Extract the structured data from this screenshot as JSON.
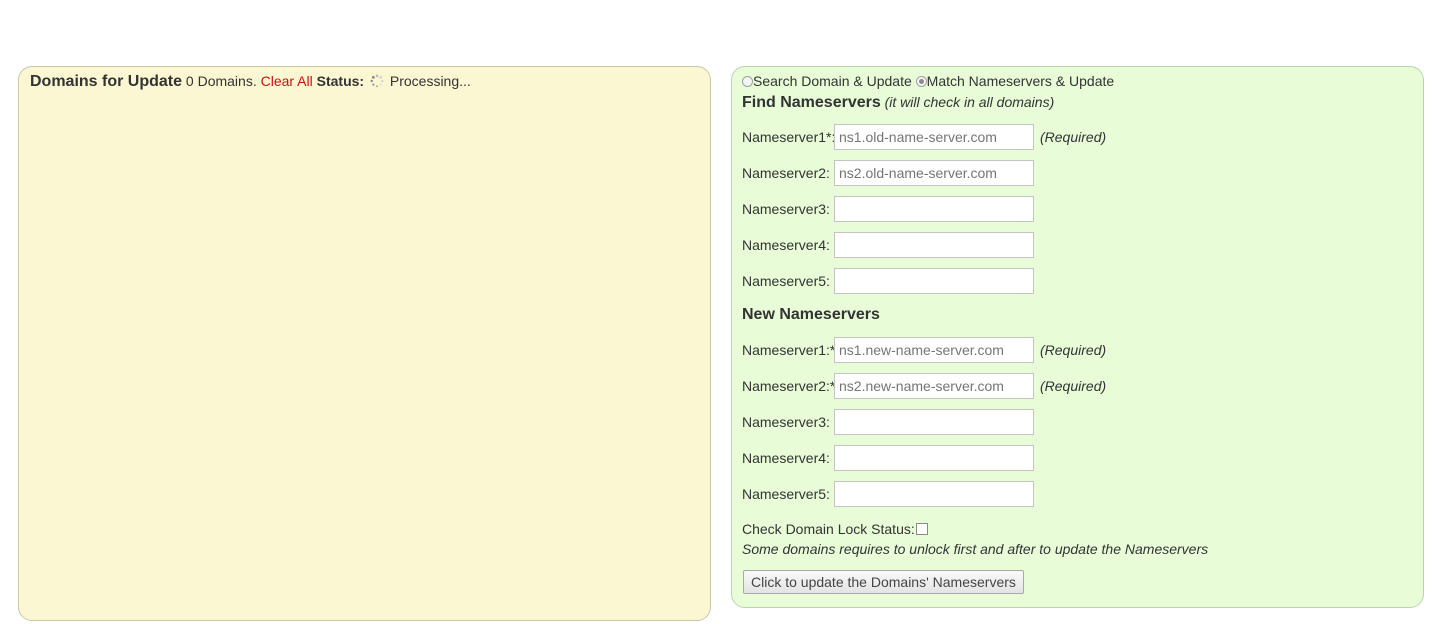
{
  "domains_panel": {
    "title": "Domains for Update",
    "count_text": "0 Domains.",
    "clear_all": "Clear All",
    "status_label": "Status:",
    "status_value": "Processing..."
  },
  "mode": {
    "options": [
      {
        "label": "Search Domain & Update",
        "checked": false
      },
      {
        "label": "Match Nameservers & Update",
        "checked": true
      }
    ]
  },
  "find_section": {
    "title": "Find Nameservers",
    "note": "(it will check in all domains)",
    "fields": [
      {
        "label": "Nameserver1*:",
        "placeholder": "ns1.old-name-server.com",
        "value": "",
        "required_note": "(Required)"
      },
      {
        "label": "Nameserver2:",
        "placeholder": "ns2.old-name-server.com",
        "value": "",
        "required_note": ""
      },
      {
        "label": "Nameserver3:",
        "placeholder": "",
        "value": "",
        "required_note": ""
      },
      {
        "label": "Nameserver4:",
        "placeholder": "",
        "value": "",
        "required_note": ""
      },
      {
        "label": "Nameserver5:",
        "placeholder": "",
        "value": "",
        "required_note": ""
      }
    ]
  },
  "new_section": {
    "title": "New Nameservers",
    "fields": [
      {
        "label": "Nameserver1:*",
        "placeholder": "ns1.new-name-server.com",
        "value": "",
        "required_note": "(Required)"
      },
      {
        "label": "Nameserver2:*",
        "placeholder": "ns2.new-name-server.com",
        "value": "",
        "required_note": "(Required)"
      },
      {
        "label": "Nameserver3:",
        "placeholder": "",
        "value": "",
        "required_note": ""
      },
      {
        "label": "Nameserver4:",
        "placeholder": "",
        "value": "",
        "required_note": ""
      },
      {
        "label": "Nameserver5:",
        "placeholder": "",
        "value": "",
        "required_note": ""
      }
    ]
  },
  "lock": {
    "label": "Check Domain Lock Status:",
    "checked": false,
    "note": "Some domains requires to unlock first and after to update the Nameservers"
  },
  "submit_label": "Click to update the Domains' Nameservers"
}
